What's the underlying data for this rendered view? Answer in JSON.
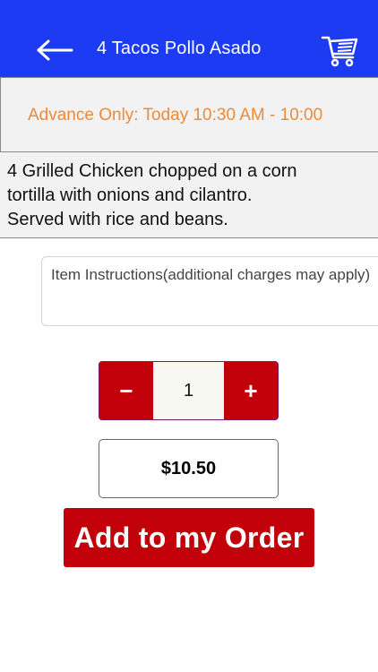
{
  "header": {
    "title": "4 Tacos Pollo Asado",
    "back_icon": "arrow-left-icon",
    "cart_icon": "shopping-cart-icon",
    "background": "#1d3bf2"
  },
  "advance_notice": {
    "text": "Advance Only: Today 10:30 AM - 10:00",
    "color": "#ee8a3a"
  },
  "description": {
    "lines": [
      "4 Grilled Chicken chopped on a corn",
      "tortilla with onions and cilantro.",
      "Served with rice and beans."
    ]
  },
  "instructions": {
    "placeholder": "Item Instructions(additional charges may apply)"
  },
  "quantity": {
    "decrement_label": "−",
    "value": "1",
    "increment_label": "+"
  },
  "price": {
    "text": "$10.50"
  },
  "add_button": {
    "label": "Add to my Order",
    "color": "#c20009"
  }
}
